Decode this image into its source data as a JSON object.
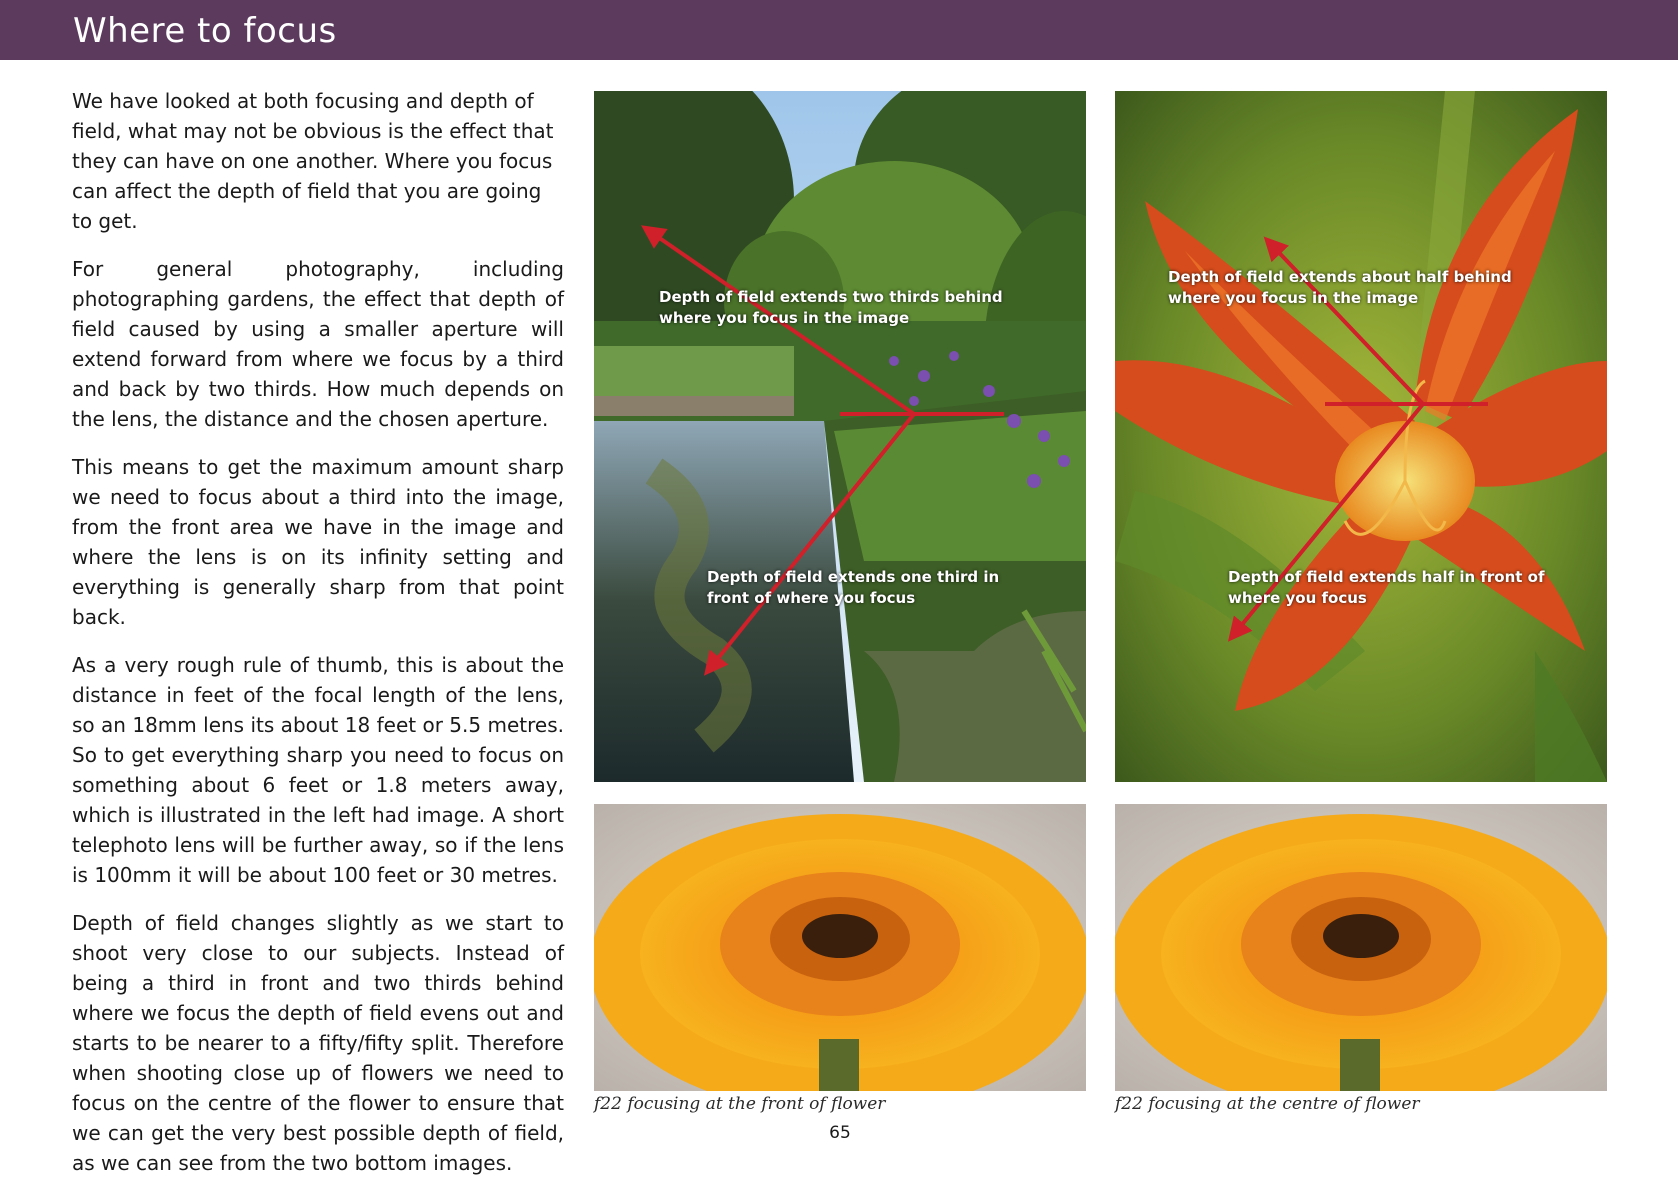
{
  "header": {
    "title": "Where to focus",
    "color": "#5c3a5e"
  },
  "body": {
    "paragraphs": [
      "We have looked at both focusing and depth of field, what may not be obvious is the effect that they can have on one another. Where you focus can affect the depth of field that you are going to get.",
      "For general photography, including photographing gardens, the effect that depth of field caused by using a smaller aperture will extend forward from where we focus by a third and back by two thirds. How much depends on the lens, the distance and the chosen aperture.",
      "This means to get the maximum amount sharp we need to focus about a third into the image, from the front area we have in the image and where the lens is on its infinity setting and everything is generally sharp from that point back.",
      "As a very rough rule of thumb, this is about the distance in feet of the focal length of the lens, so an 18mm lens its about 18 feet or 5.5 metres.  So to get everything sharp you need to focus on something about  6 feet or 1.8 meters away, which is illustrated in the left had image. A short telephoto lens will be further away, so if the lens is 100mm it will be about 100 feet or 30 metres.",
      "Depth of field changes slightly as we start to shoot very close to our subjects. Instead of being a third in front and two thirds behind where we focus the depth of field evens out and starts to be nearer to a fifty/fifty split. Therefore when shooting close up of flowers we need to focus on the centre of the flower to ensure that we can get the very best possible depth of field, as we can see from the two bottom images."
    ]
  },
  "figures": {
    "garden": {
      "behind_line1": "Depth of field extends two thirds behind",
      "behind_line2": "where you focus in the image",
      "front_line1": "Depth of field extends one third in",
      "front_line2": "front of where you focus"
    },
    "lily": {
      "behind_line1": "Depth of field extends about half behind",
      "behind_line2": "where you focus in the image",
      "front_line1": "Depth of field extends half in front of",
      "front_line2": "where you focus"
    },
    "arrow_color": "#d0202a"
  },
  "captions": {
    "front": "f22 focusing at the front of flower",
    "centre": "f22 focusing at the centre of flower"
  },
  "page_number": "65"
}
